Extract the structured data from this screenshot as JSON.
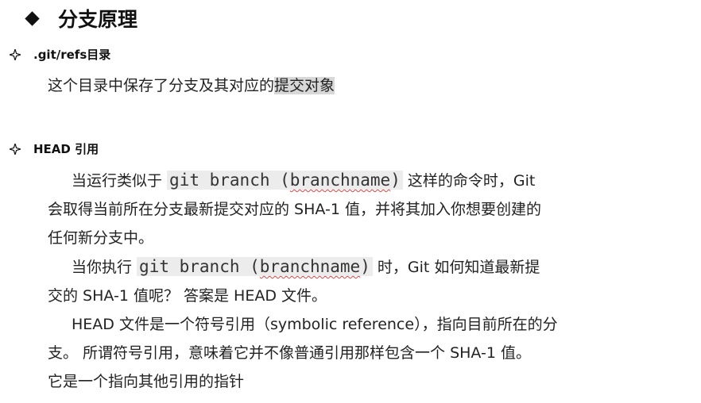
{
  "title": "分支原理",
  "section1": {
    "heading": ".git/refs目录",
    "text_before_highlight": "这个目录中保存了分支及其对应的",
    "text_highlight": "提交对象"
  },
  "section2": {
    "heading": "HEAD 引用",
    "lines": [
      {
        "indent": true,
        "pre": "当运行类似于 ",
        "code_a": "git branch (",
        "code_b": "branchname",
        "code_c": ")",
        "post": " 这样的命令时，Git"
      },
      {
        "indent": false,
        "text": "会取得当前所在分支最新提交对应的 SHA-1 值，并将其加入你想要创建的"
      },
      {
        "indent": false,
        "text": "任何新分支中。"
      },
      {
        "indent": true,
        "pre": "当你执行 ",
        "code_a": "git branch (",
        "code_b": "branchname",
        "code_c": ")",
        "post": " 时，Git 如何知道最新提"
      },
      {
        "indent": false,
        "text": "交的 SHA-1 值呢？ 答案是 HEAD 文件。"
      },
      {
        "indent": true,
        "text": "HEAD 文件是一个符号引用（symbolic reference），指向目前所在的分"
      },
      {
        "indent": false,
        "text": "支。 所谓符号引用，意味着它并不像普通引用那样包含一个 SHA-1 值。"
      },
      {
        "indent": false,
        "text": "它是一个指向其他引用的指针"
      }
    ]
  }
}
